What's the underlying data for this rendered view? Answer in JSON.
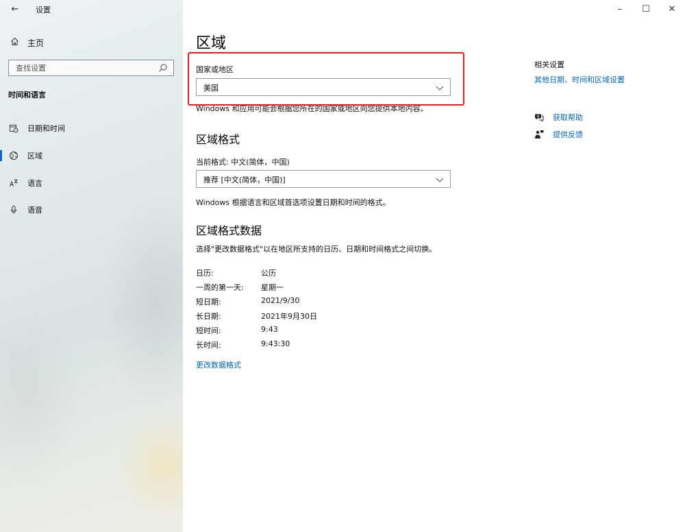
{
  "window": {
    "title": "设置",
    "minimize_icon": "–",
    "maximize_icon": "☐",
    "close_icon": "✕"
  },
  "sidebar": {
    "home_label": "主页",
    "search_placeholder": "查找设置",
    "section_title": "时间和语言",
    "items": [
      {
        "label": "日期和时间",
        "icon": "calendar-clock-icon",
        "active": false
      },
      {
        "label": "区域",
        "icon": "globe-region-icon",
        "active": true
      },
      {
        "label": "语言",
        "icon": "language-icon",
        "active": false
      },
      {
        "label": "语音",
        "icon": "microphone-icon",
        "active": false
      }
    ]
  },
  "main": {
    "title": "区域",
    "country": {
      "label": "国家或地区",
      "selected": "美国",
      "description": "Windows 和应用可能会根据您所在的国家或地区向您提供本地内容。"
    },
    "regional_format": {
      "heading": "区域格式",
      "current_label": "当前格式: 中文(简体，中国)",
      "selected": "推荐 [中文(简体，中国)]",
      "description": "Windows 根据语言和区域首选项设置日期和时间的格式。"
    },
    "format_data": {
      "heading": "区域格式数据",
      "description": "选择\"更改数据格式\"以在地区所支持的日历、日期和时间格式之间切换。",
      "rows": [
        {
          "key": "日历:",
          "value": "公历"
        },
        {
          "key": "一周的第一天:",
          "value": "星期一"
        },
        {
          "key": "短日期:",
          "value": "2021/9/30"
        },
        {
          "key": "长日期:",
          "value": "2021年9月30日"
        },
        {
          "key": "短时间:",
          "value": "9:43"
        },
        {
          "key": "长时间:",
          "value": "9:43:30"
        }
      ],
      "change_link": "更改数据格式"
    }
  },
  "related": {
    "title": "相关设置",
    "link": "其他日期、时间和区域设置",
    "help": "获取帮助",
    "feedback": "提供反馈"
  },
  "colors": {
    "accent": "#0067c0",
    "link": "#0066b4",
    "highlight": "#e02020"
  }
}
